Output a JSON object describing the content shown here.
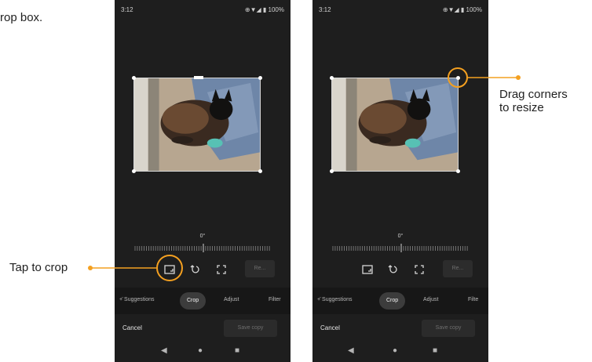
{
  "intro_caption": "rop box.",
  "phones": [
    {
      "status": {
        "time": "3:12",
        "system": "⊕▼◢ ▮ 100%"
      },
      "angle_label": "0°",
      "tools": {
        "crop": "crop-frame-icon",
        "rotate": "rotate-icon",
        "expand": "expand-icon",
        "reset_label": "Re..."
      },
      "tabs": {
        "suggestions": "+̈ Suggestions",
        "crop": "Crop",
        "adjust": "Adjust",
        "filters": "Filter"
      },
      "cancel_label": "Cancel",
      "save_label": "Save copy",
      "nav": {
        "back": "◀",
        "home": "●",
        "recents": "■"
      }
    },
    {
      "status": {
        "time": "3:12",
        "system": "⊕▼◢ ▮ 100%"
      },
      "angle_label": "0°",
      "tools": {
        "crop": "crop-frame-icon",
        "rotate": "rotate-icon",
        "expand": "expand-icon",
        "reset_label": "Re..."
      },
      "tabs": {
        "suggestions": "+̈ Suggestions",
        "crop": "Crop",
        "adjust": "Adjust",
        "filters": "Filte"
      },
      "cancel_label": "Cancel",
      "save_label": "Save copy",
      "nav": {
        "back": "◀",
        "home": "●",
        "recents": "■"
      }
    }
  ],
  "callouts": {
    "tap_crop": "Tap to crop",
    "drag_line1": "Drag corners",
    "drag_line2": "to resize"
  },
  "colors": {
    "accent_orange": "#f4a020",
    "phone_bg": "#1e1e1e"
  }
}
